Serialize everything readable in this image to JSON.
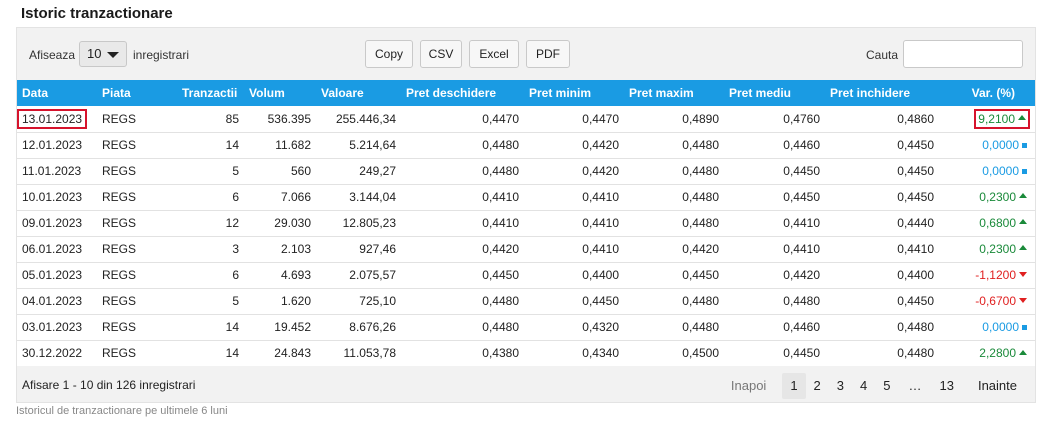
{
  "title": "Istoric tranzactionare",
  "toolbar": {
    "show_label": "Afiseaza",
    "page_length": "10",
    "entries_label": "inregistrari",
    "buttons": [
      "Copy",
      "CSV",
      "Excel",
      "PDF"
    ],
    "search_label": "Cauta",
    "search_value": ""
  },
  "table": {
    "columns": [
      "Data",
      "Piata",
      "Tranzactii",
      "Volum",
      "Valoare",
      "Pret deschidere",
      "Pret minim",
      "Pret maxim",
      "Pret mediu",
      "Pret inchidere",
      "Var. (%)"
    ],
    "rows": [
      [
        "13.01.2023",
        "REGS",
        "85",
        "536.395",
        "255.446,34",
        "0,4470",
        "0,4470",
        "0,4890",
        "0,4760",
        "0,4860",
        "9,2100",
        "up"
      ],
      [
        "12.01.2023",
        "REGS",
        "14",
        "11.682",
        "5.214,64",
        "0,4480",
        "0,4420",
        "0,4480",
        "0,4460",
        "0,4450",
        "0,0000",
        "flat"
      ],
      [
        "11.01.2023",
        "REGS",
        "5",
        "560",
        "249,27",
        "0,4480",
        "0,4420",
        "0,4480",
        "0,4450",
        "0,4450",
        "0,0000",
        "flat"
      ],
      [
        "10.01.2023",
        "REGS",
        "6",
        "7.066",
        "3.144,04",
        "0,4410",
        "0,4410",
        "0,4480",
        "0,4450",
        "0,4450",
        "0,2300",
        "up"
      ],
      [
        "09.01.2023",
        "REGS",
        "12",
        "29.030",
        "12.805,23",
        "0,4410",
        "0,4410",
        "0,4480",
        "0,4410",
        "0,4440",
        "0,6800",
        "up"
      ],
      [
        "06.01.2023",
        "REGS",
        "3",
        "2.103",
        "927,46",
        "0,4420",
        "0,4410",
        "0,4420",
        "0,4410",
        "0,4410",
        "0,2300",
        "up"
      ],
      [
        "05.01.2023",
        "REGS",
        "6",
        "4.693",
        "2.075,57",
        "0,4450",
        "0,4400",
        "0,4450",
        "0,4420",
        "0,4400",
        "-1,1200",
        "down"
      ],
      [
        "04.01.2023",
        "REGS",
        "5",
        "1.620",
        "725,10",
        "0,4480",
        "0,4450",
        "0,4480",
        "0,4480",
        "0,4450",
        "-0,6700",
        "down"
      ],
      [
        "03.01.2023",
        "REGS",
        "14",
        "19.452",
        "8.676,26",
        "0,4480",
        "0,4320",
        "0,4480",
        "0,4460",
        "0,4480",
        "0,0000",
        "flat"
      ],
      [
        "30.12.2022",
        "REGS",
        "14",
        "24.843",
        "11.053,78",
        "0,4380",
        "0,4340",
        "0,4500",
        "0,4450",
        "0,4480",
        "2,2800",
        "up"
      ]
    ]
  },
  "footer": {
    "info": "Afisare 1 - 10 din 126 inregistrari",
    "prev": "Inapoi",
    "pages": [
      "1",
      "2",
      "3",
      "4",
      "5",
      "…",
      "13"
    ],
    "active_page": "1",
    "next": "Inainte"
  },
  "caption": "Istoricul de tranzactionare pe ultimele 6 luni",
  "colors": {
    "header_bg": "#1a9be3",
    "positive": "#1a8a3a",
    "negative": "#e02020",
    "neutral": "#1a9be3",
    "highlight": "#d6132c"
  },
  "icons": {
    "up": "triangle-up-icon",
    "down": "triangle-down-icon",
    "flat": "square-dot-icon",
    "dropdown": "chevron-down-icon"
  }
}
